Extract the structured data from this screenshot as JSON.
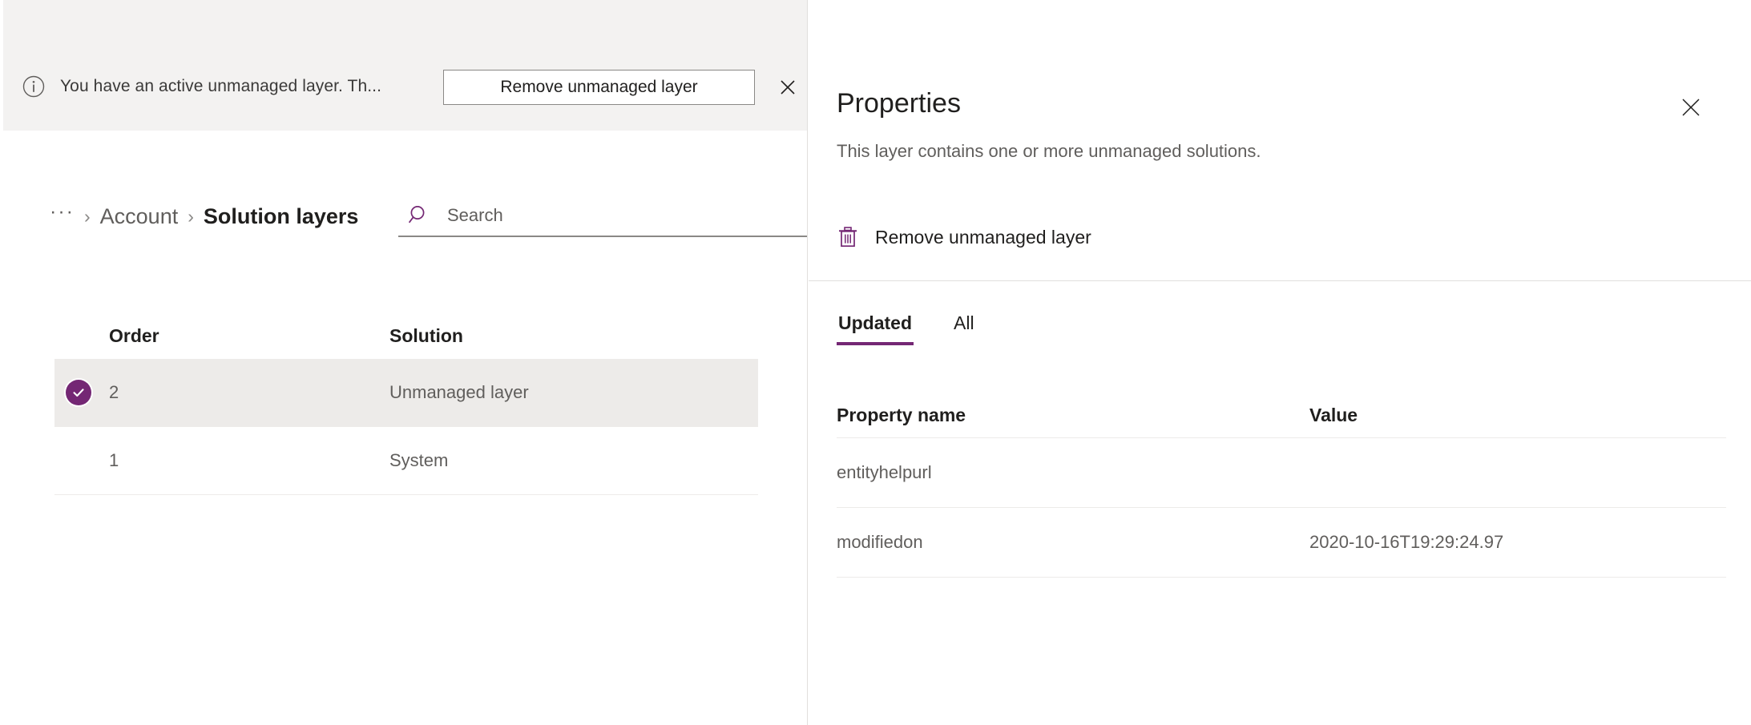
{
  "colors": {
    "accent": "#742774",
    "notification_bg": "#f3f2f1",
    "row_selected_bg": "#edebe9",
    "border": "#e1dfdd",
    "text_primary": "#201f1e",
    "text_secondary": "#605e5c"
  },
  "notification": {
    "icon": "info-circle-icon",
    "message": "You have an active unmanaged layer. Th...",
    "action_label": "Remove unmanaged layer",
    "close_icon": "close-icon"
  },
  "breadcrumb": {
    "overflow": "···",
    "separator": "›",
    "parent": "Account",
    "current": "Solution layers"
  },
  "search": {
    "icon": "search-icon",
    "placeholder": "Search",
    "value": ""
  },
  "layers_table": {
    "columns": [
      "Order",
      "Solution"
    ],
    "rows": [
      {
        "order": "2",
        "solution": "Unmanaged layer",
        "selected": true
      },
      {
        "order": "1",
        "solution": "System",
        "selected": false
      }
    ]
  },
  "properties_panel": {
    "title": "Properties",
    "subtitle": "This layer contains one or more unmanaged solutions.",
    "close_icon": "close-icon",
    "command": {
      "icon": "trash-icon",
      "label": "Remove unmanaged layer"
    },
    "tabs": [
      {
        "label": "Updated",
        "active": true
      },
      {
        "label": "All",
        "active": false
      }
    ],
    "table": {
      "columns": [
        "Property name",
        "Value"
      ],
      "rows": [
        {
          "name": "entityhelpurl",
          "value": ""
        },
        {
          "name": "modifiedon",
          "value": "2020-10-16T19:29:24.97"
        }
      ]
    }
  }
}
